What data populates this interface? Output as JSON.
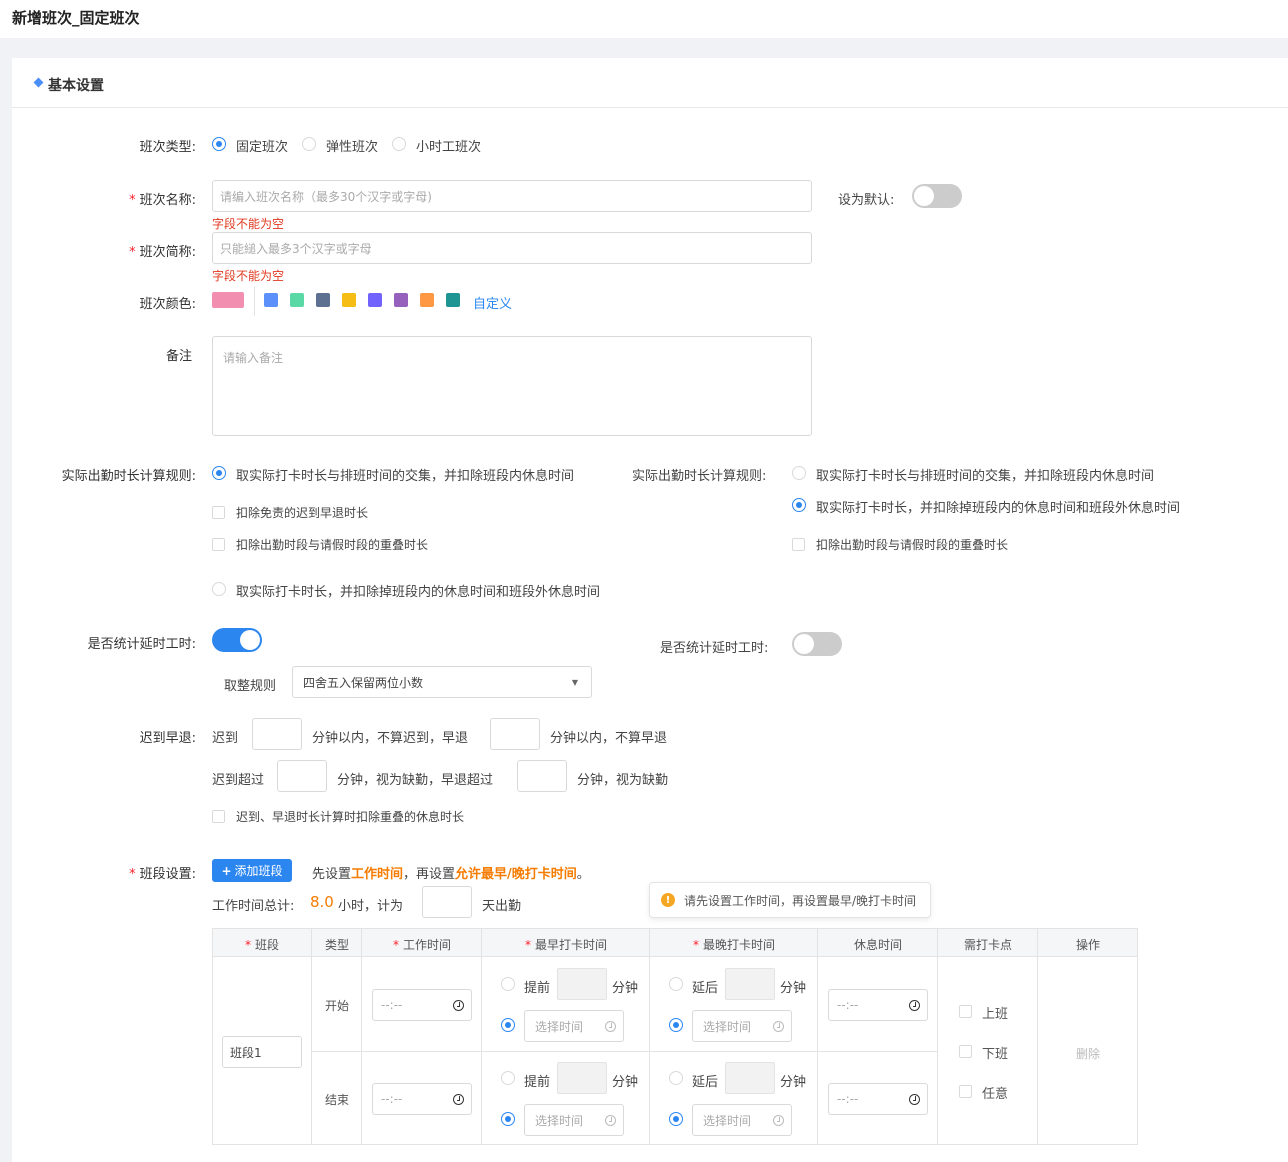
{
  "page": {
    "title": "新增班次_固定班次"
  },
  "section": {
    "title": "基本设置"
  },
  "shift_type": {
    "label": "班次类型:",
    "options": [
      "固定班次",
      "弹性班次",
      "小时工班次"
    ],
    "selected": "固定班次"
  },
  "shift_name": {
    "label": "班次名称:",
    "placeholder": "请编入班次名称（最多30个汉字或字母)",
    "error": "字段不能为空",
    "default_label": "设为默认:",
    "default_on": false
  },
  "shift_short": {
    "label": "班次简称:",
    "placeholder": "只能縋入最多3个汉字或字母",
    "error": "字段不能为空"
  },
  "shift_color": {
    "label": "班次颜色:",
    "selected": "#f28fb0",
    "palette": [
      "#5b8ff9",
      "#5ad8a6",
      "#5d7092",
      "#f6bd16",
      "#7262fd",
      "#9661bc",
      "#ff9845",
      "#1e9493"
    ],
    "custom_label": "自定义"
  },
  "remark": {
    "label": "备注",
    "placeholder": "请输入备注"
  },
  "calc_rule": {
    "label": "实际出勤时长计算规则:",
    "option_a": "取实际打卡时长与排班时间的交集，并扣除班段内休息时间",
    "check_a1": "扣除免责的迟到早退时长",
    "check_a2": "扣除出勤时段与请假时段的重叠时长",
    "option_b": "取实际打卡时长，并扣除掉班段内的休息时间和班段外休息时间",
    "selected_left": "a",
    "right_label": "实际出勤时长计算规则:",
    "right_option_a": "取实际打卡时长与排班时间的交集，并扣除班段内休息时间",
    "right_option_b": "取实际打卡时长，并扣除掉班段内的休息时间和班段外休息时间",
    "right_check": "扣除出勤时段与请假时段的重叠时长",
    "selected_right": "b"
  },
  "overtime": {
    "label": "是否统计延时工时:",
    "on": true,
    "right_label": "是否统计延时工时:",
    "right_on": false,
    "rounding_label": "取整规则",
    "rounding_value": "四舍五入保留两位小数"
  },
  "late_early": {
    "label": "迟到早退:",
    "row1_a": "迟到",
    "row1_b": "分钟以内，不算迟到，早退",
    "row1_c": "分钟以内，不算早退",
    "row2_a": "迟到超过",
    "row2_b": "分钟，视为缺勤，早退超过",
    "row2_c": "分钟，视为缺勤",
    "check": "迟到、早退时长计算时扣除重叠的休息时长"
  },
  "segments": {
    "label": "班段设置:",
    "add_button": "添加班段",
    "hint_prefix": "先设置",
    "hint_work": "工作时间",
    "hint_mid": "，再设置",
    "hint_allow": "允许最早/晚打卡时间",
    "hint_end": "。",
    "total_label": "工作时间总计:",
    "total_value": "8.0",
    "total_unit": "小时，计为",
    "days_label": "天出勤",
    "tooltip": "请先设置工作时间，再设置最早/晚打卡时间",
    "headers": [
      "班段",
      "类型",
      "工作时间",
      "最早打卡时间",
      "最晚打卡时间",
      "休息时间",
      "需打卡点",
      "操作"
    ],
    "segment_name": "班段1",
    "type_start": "开始",
    "type_end": "结束",
    "time_placeholder": "--:--",
    "early_label": "提前",
    "late_label": "延后",
    "minute_label": "分钟",
    "select_time": "选择时间",
    "checkpoints": [
      "上班",
      "下班",
      "任意"
    ],
    "delete_label": "删除"
  },
  "colors": {
    "primary": "#2b86f0",
    "error": "#e0391f",
    "accent": "#f57c00"
  }
}
